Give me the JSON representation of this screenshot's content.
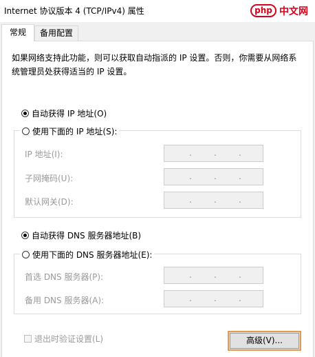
{
  "window": {
    "title": "Internet 协议版本 4 (TCP/IPv4) 属性"
  },
  "watermark": {
    "badge": "php",
    "text": "中文网"
  },
  "tabs": [
    {
      "label": "常规",
      "selected": true
    },
    {
      "label": "备用配置",
      "selected": false
    }
  ],
  "description": "如果网络支持此功能，则可以获取自动指派的 IP 设置。否则，你需要从网络系统管理员处获得适当的 IP 设置。",
  "ip": {
    "auto_label": "自动获得 IP 地址(O)",
    "auto_selected": true,
    "manual_label": "使用下面的 IP 地址(S):",
    "manual_selected": false,
    "fields": [
      {
        "label": "IP 地址(I):"
      },
      {
        "label": "子网掩码(U):"
      },
      {
        "label": "默认网关(D):"
      }
    ]
  },
  "dns": {
    "auto_label": "自动获得 DNS 服务器地址(B)",
    "auto_selected": true,
    "manual_label": "使用下面的 DNS 服务器地址(E):",
    "manual_selected": false,
    "fields": [
      {
        "label": "首选 DNS 服务器(P):"
      },
      {
        "label": "备用 DNS 服务器(A):"
      }
    ]
  },
  "ip_separator": ".",
  "validate_on_exit": {
    "label": "退出时验证设置(L)",
    "checked": false
  },
  "advanced_button": "高级(V)..."
}
